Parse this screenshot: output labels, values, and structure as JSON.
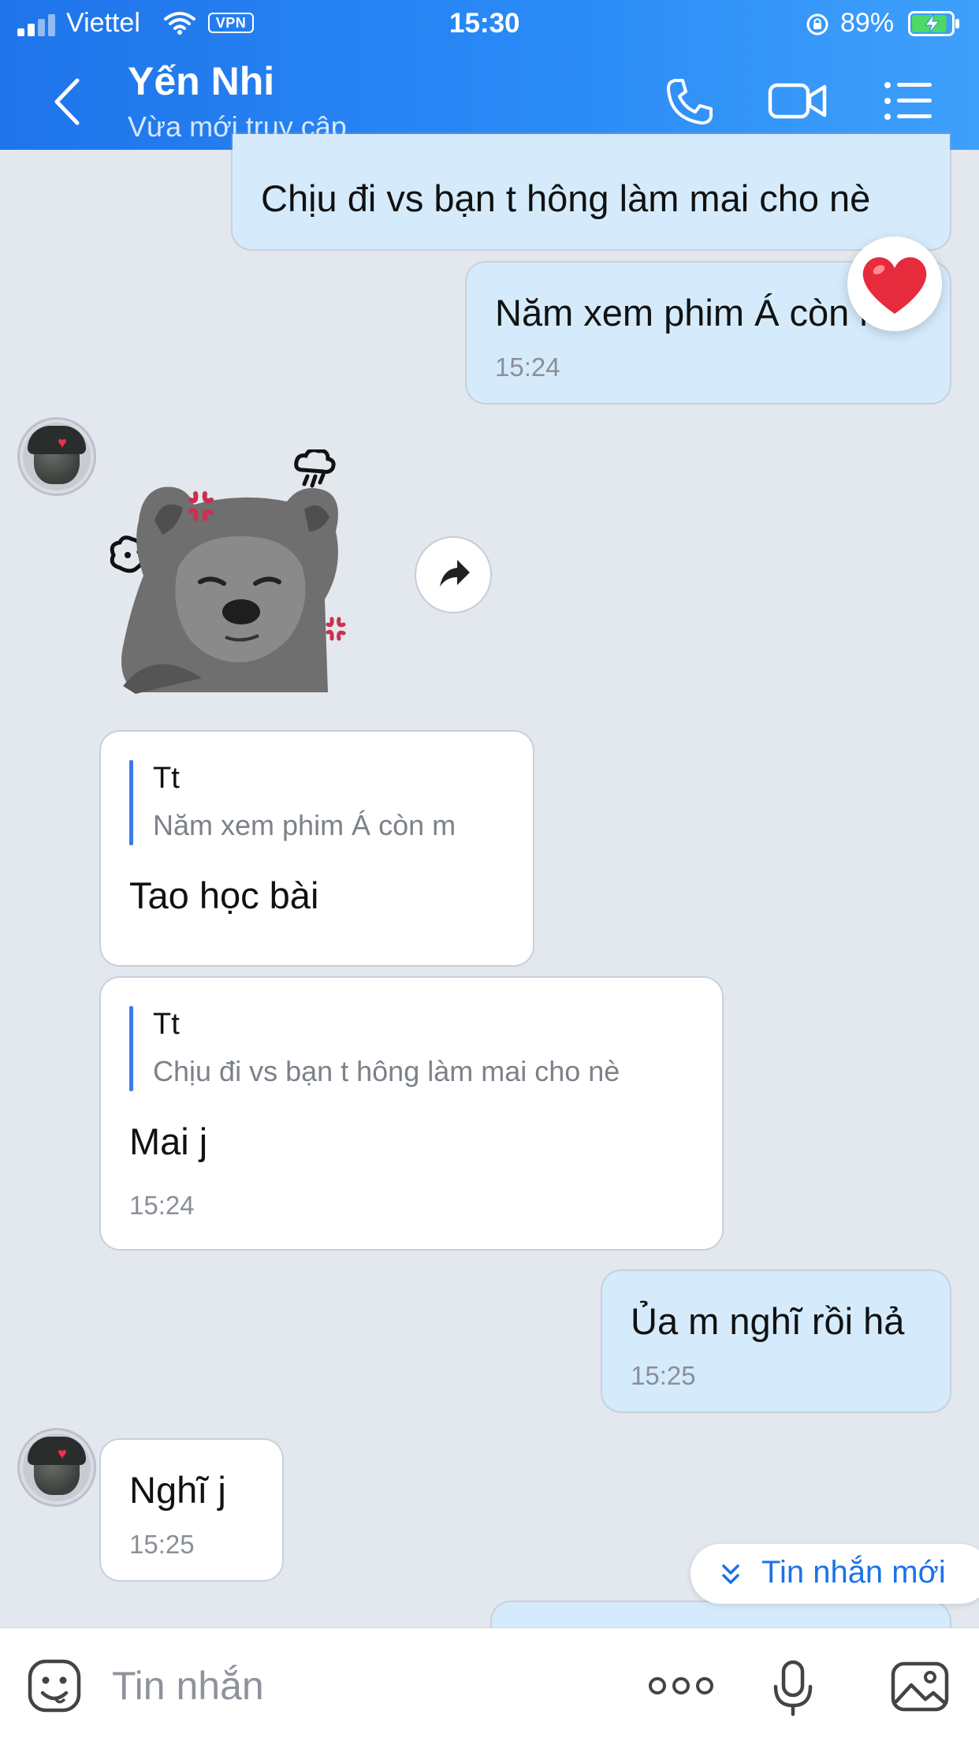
{
  "status_bar": {
    "carrier": "Viettel",
    "vpn": "VPN",
    "time": "15:30",
    "battery": "89%",
    "battery_level": 0.89
  },
  "header": {
    "contact_name": "Yến Nhi",
    "contact_status": "Vừa mới truy cập"
  },
  "messages": [
    {
      "side": "me",
      "text": "Chịu đi vs bạn t hông làm mai cho nè"
    },
    {
      "side": "me",
      "text": "Năm xem phim Á còn m",
      "time": "15:24",
      "reaction": "heart-icon"
    },
    {
      "side": "them",
      "type": "sticker",
      "sticker": "angry-dog-sticker"
    },
    {
      "side": "them",
      "quote_author": "Tt",
      "quote_text": "Năm xem phim Á còn m",
      "text": "Tao học bài"
    },
    {
      "side": "them",
      "quote_author": "Tt",
      "quote_text": "Chịu đi vs bạn t hông làm mai cho nè",
      "text": "Mai j",
      "time": "15:24"
    },
    {
      "side": "me",
      "text": "Ủa m nghĩ rồi hả",
      "time": "15:25"
    },
    {
      "side": "them",
      "text": "Nghĩ j",
      "time": "15:25"
    }
  ],
  "new_messages_pill": "Tin nhắn mới",
  "composer": {
    "placeholder": "Tin nhắn"
  },
  "colors": {
    "header_gradient_start": "#1f74ea",
    "header_gradient_end": "#3ea0fb",
    "my_bubble": "#d5ebfb",
    "their_bubble": "#ffffff",
    "background": "#e3e7ee",
    "accent": "#1a73e8"
  }
}
